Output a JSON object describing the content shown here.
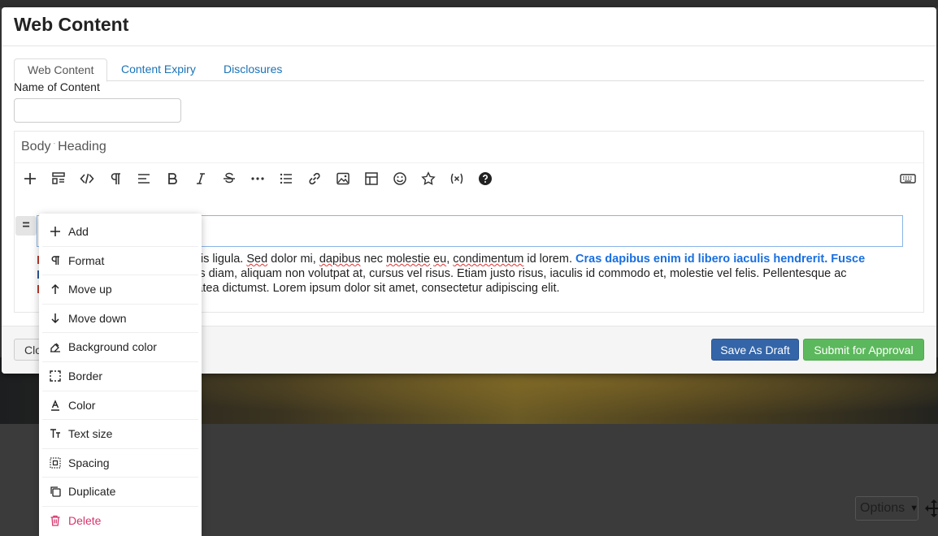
{
  "modal": {
    "title": "Web Content",
    "tabs": [
      {
        "label": "Web Content"
      },
      {
        "label": "Content Expiry"
      },
      {
        "label": "Disclosures"
      }
    ],
    "name_label": "Name of Content",
    "name_value": "",
    "breadcrumb": [
      "Body",
      "Heading"
    ],
    "toolbar_icons": [
      "plus-icon",
      "layout-icon",
      "code-icon",
      "paragraph-icon",
      "align-icon",
      "bold-icon",
      "italic-icon",
      "strikethrough-icon",
      "more-icon",
      "list-icon",
      "link-icon",
      "image-icon",
      "table-icon",
      "emoji-icon",
      "star-icon",
      "variable-icon",
      "help-icon",
      "keyboard-icon"
    ],
    "block_handle": "=",
    "paragraph": {
      "line1_start": "ortis ligula. ",
      "line1_sed": "Sed",
      "line1_mid1": " dolor mi, ",
      "line1_dapibus": "dapibus",
      "line1_mid2": " nec ",
      "line1_molestie": "molestie",
      "line1_mid3": " ",
      "line1_eu": "eu",
      "line1_mid4": ", ",
      "line1_condimentum": "condimentum",
      "line1_end": " id lorem. ",
      "line1_bold": "Cras dapibus enim id libero iaculis hendrerit. Fusce",
      "line2": "sus diam, aliquam non volutpat at, cursus vel risus. Etiam justo risus, iaculis id commodo et, molestie vel felis. Pellentesque ac",
      "line3": "platea dictumst. Lorem ipsum dolor sit amet, consectetur adipiscing elit."
    },
    "footer": {
      "close_label": "Clo",
      "draft_label": "Save As Draft",
      "approve_label": "Submit for Approval"
    }
  },
  "context_menu": {
    "items": [
      {
        "label": "Add",
        "icon": "plus-icon"
      },
      {
        "label": "Format",
        "icon": "paragraph-icon"
      },
      {
        "label": "Move up",
        "icon": "arrow-up-icon"
      },
      {
        "label": "Move down",
        "icon": "arrow-down-icon"
      },
      {
        "label": "Background color",
        "icon": "paint-icon"
      },
      {
        "label": "Border",
        "icon": "border-icon"
      },
      {
        "label": "Color",
        "icon": "text-color-icon"
      },
      {
        "label": "Text size",
        "icon": "text-size-icon"
      },
      {
        "label": "Spacing",
        "icon": "spacing-icon"
      },
      {
        "label": "Duplicate",
        "icon": "duplicate-icon"
      },
      {
        "label": "Delete",
        "icon": "trash-icon"
      }
    ],
    "danger_color": "#d6336c"
  },
  "page": {
    "options_label": "Options"
  },
  "colors": {
    "primary_button": "#3465a8",
    "success_button": "#5cb85c",
    "link": "#1a73b8",
    "bold_text": "#1a6fe0"
  }
}
